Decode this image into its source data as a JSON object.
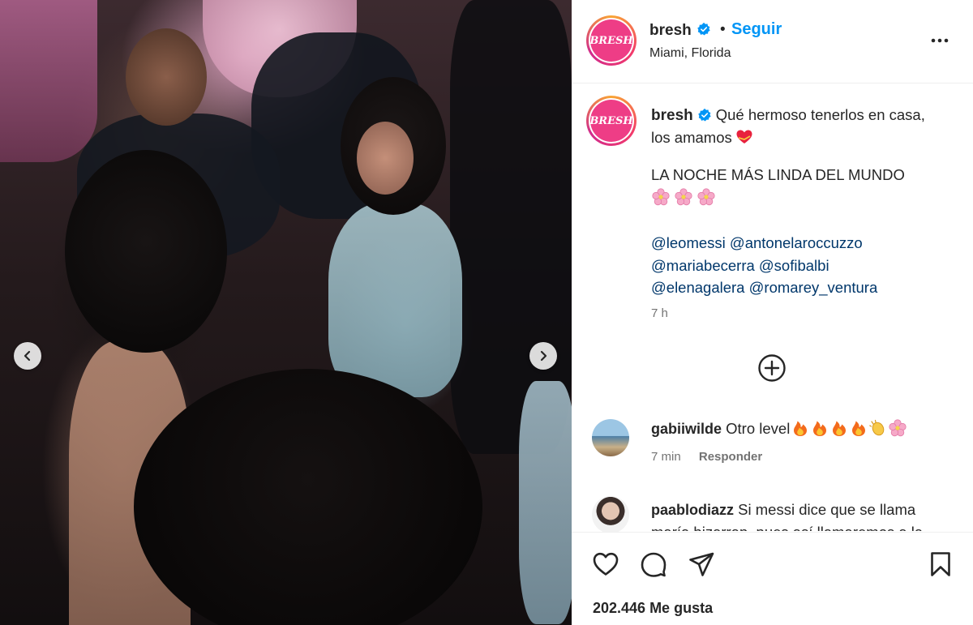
{
  "account": {
    "username": "bresh",
    "verified": true,
    "follow_label": "Seguir",
    "separator": "•",
    "location": "Miami, Florida",
    "avatar_logo_text": "BRESH",
    "brand_color": "#ee3d86",
    "link_color": "#0095f6"
  },
  "caption": {
    "username": "bresh",
    "text_line1": "Qué hermoso tenerlos en casa, los amamos",
    "text_line2": "LA NOCHE MÁS LINDA DEL MUNDO",
    "emoji_after_line1": "heart-ribbon-icon",
    "flower_count": 3,
    "mentions": [
      "@leomessi",
      "@antonelaroccuzzo",
      "@mariabecerra",
      "@sofibalbi",
      "@elenagalera",
      "@romarey_ventura"
    ],
    "time": "7 h"
  },
  "comments": [
    {
      "username": "gabiiwilde",
      "text": "Otro level",
      "emojis": [
        "fire-icon",
        "fire-icon",
        "fire-icon",
        "fire-icon",
        "clap-icon",
        "flower-icon"
      ],
      "time": "7 min",
      "reply_label": "Responder"
    },
    {
      "username": "paablodiazz",
      "text": "Si messi dice que se llama maría bizarrap, pues así llamaremos a la"
    }
  ],
  "actions": {
    "like_icon": "heart-outline-icon",
    "comment_icon": "comment-icon",
    "share_icon": "paper-plane-icon",
    "save_icon": "bookmark-icon"
  },
  "likes_text": "202.446 Me gusta",
  "carousel": {
    "prev_icon": "chevron-left-icon",
    "next_icon": "chevron-right-icon"
  }
}
